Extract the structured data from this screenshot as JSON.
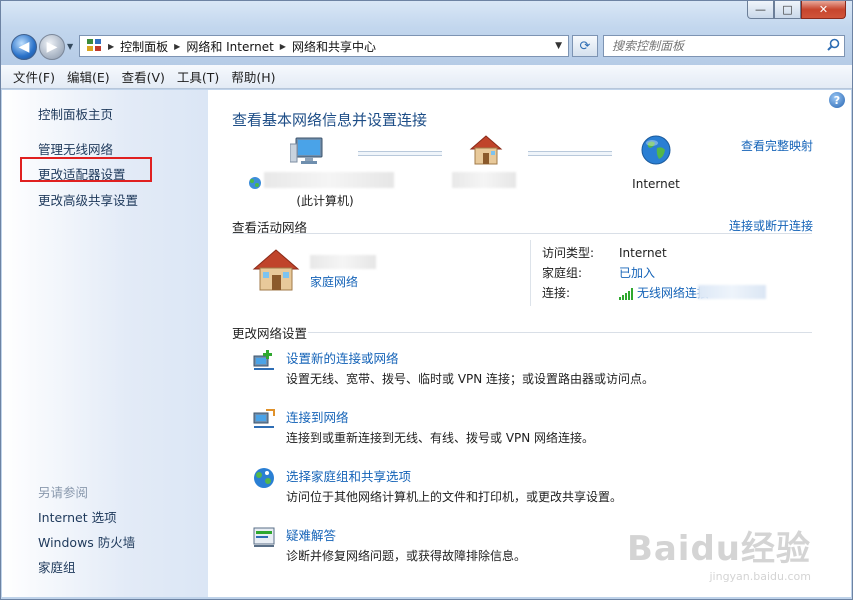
{
  "window": {
    "caption": {
      "minimize": "—",
      "maximize": "□",
      "close": "✕"
    }
  },
  "nav": {
    "back": "◀",
    "forward": "▶",
    "breadcrumb": [
      "控制面板",
      "网络和 Internet",
      "网络和共享中心"
    ],
    "search_placeholder": "搜索控制面板"
  },
  "menu": [
    "文件(F)",
    "编辑(E)",
    "查看(V)",
    "工具(T)",
    "帮助(H)"
  ],
  "sidebar": {
    "items": [
      "控制面板主页",
      "管理无线网络",
      "更改适配器设置",
      "更改高级共享设置"
    ],
    "highlighted_item": "更改适配器设置",
    "see_also_heading": "另请参阅",
    "see_also": [
      "Internet 选项",
      "Windows 防火墙",
      "家庭组"
    ]
  },
  "main": {
    "title": "查看基本网络信息并设置连接",
    "full_map": "查看完整映射",
    "map": {
      "this_computer": "(此计算机)",
      "internet": "Internet"
    },
    "active_network": {
      "heading": "查看活动网络",
      "connect_link": "连接或断开连接",
      "network_type": "家庭网络",
      "access_type_label": "访问类型:",
      "access_type_value": "Internet",
      "homegroup_label": "家庭组:",
      "homegroup_value": "已加入",
      "connections_label": "连接:",
      "connections_value": "无线网络连接"
    },
    "change_settings": {
      "heading": "更改网络设置",
      "tasks": [
        {
          "icon": "new-connection-icon",
          "title": "设置新的连接或网络",
          "desc": "设置无线、宽带、拨号、临时或 VPN 连接；或设置路由器或访问点。"
        },
        {
          "icon": "connect-network-icon",
          "title": "连接到网络",
          "desc": "连接到或重新连接到无线、有线、拨号或 VPN 网络连接。"
        },
        {
          "icon": "homegroup-sharing-icon",
          "title": "选择家庭组和共享选项",
          "desc": "访问位于其他网络计算机上的文件和打印机，或更改共享设置。"
        },
        {
          "icon": "troubleshoot-icon",
          "title": "疑难解答",
          "desc": "诊断并修复网络问题，或获得故障排除信息。"
        }
      ]
    }
  },
  "watermark": {
    "logo": "Baidu经验",
    "url": "jingyan.baidu.com"
  },
  "colors": {
    "link": "#1664b8",
    "title": "#1e4e87",
    "highlight": "#e02020"
  }
}
